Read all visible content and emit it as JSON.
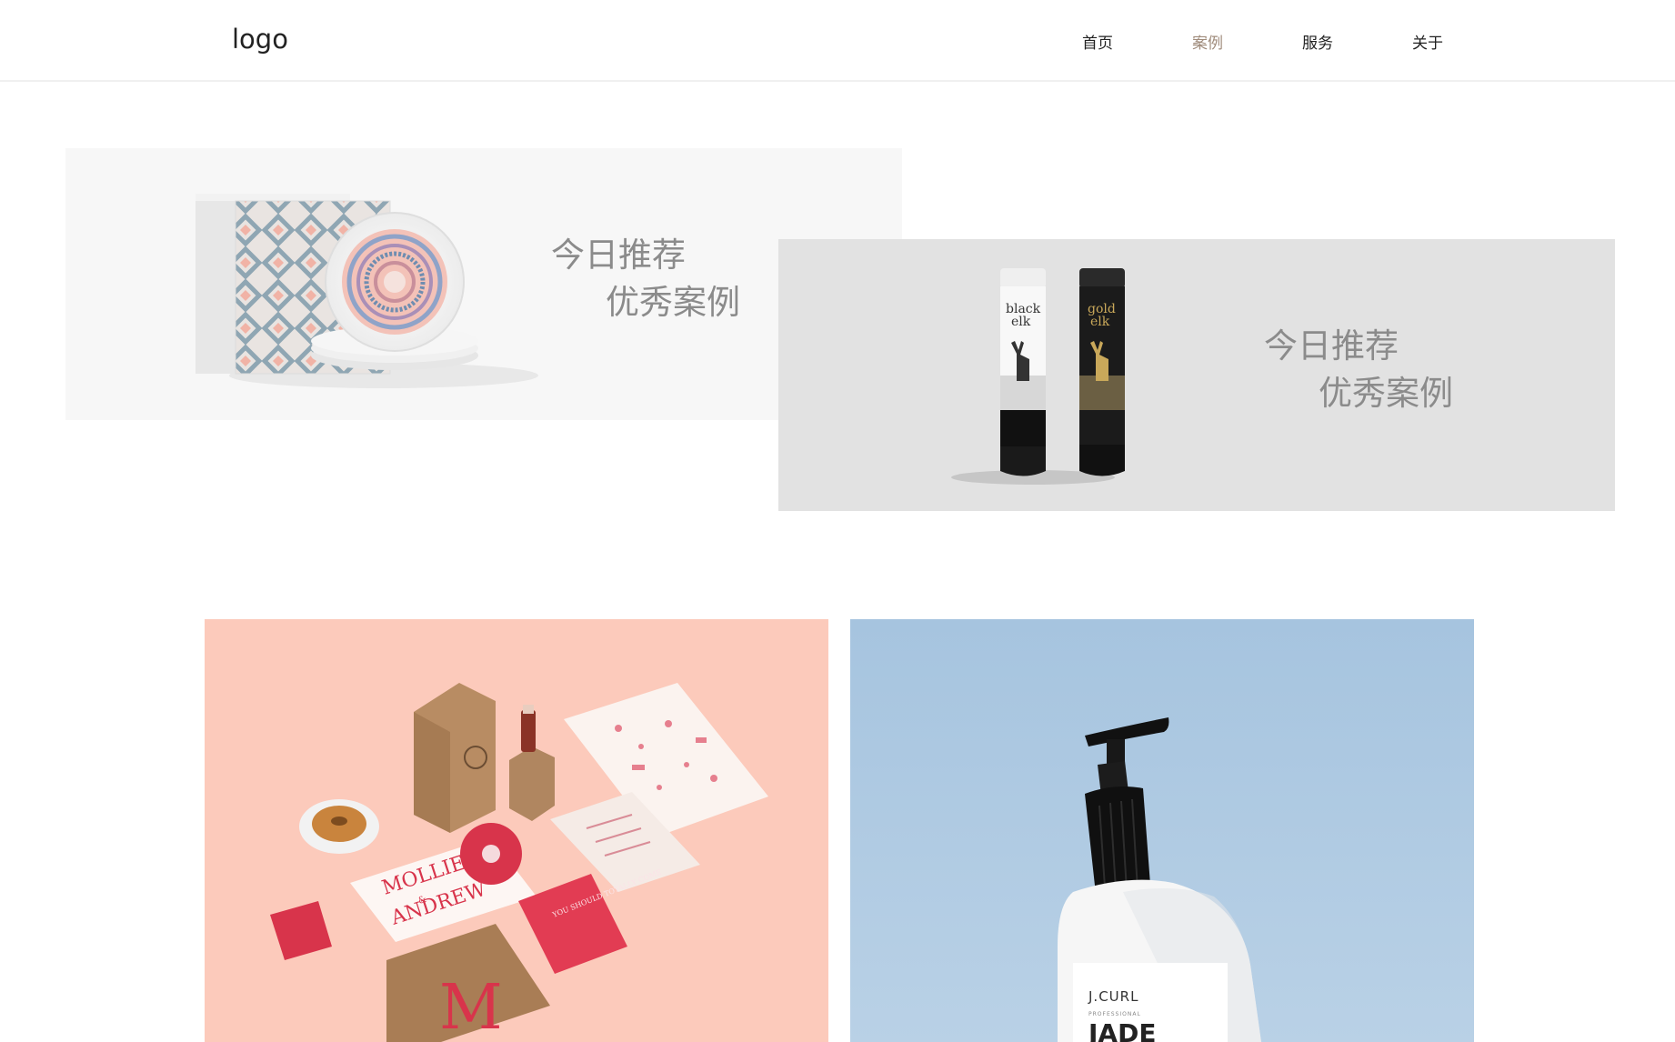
{
  "header": {
    "logo": "logo",
    "nav": [
      {
        "label": "首页",
        "active": false
      },
      {
        "label": "案例",
        "active": true
      },
      {
        "label": "服务",
        "active": false
      },
      {
        "label": "关于",
        "active": false
      }
    ]
  },
  "featured": [
    {
      "title": "今日推荐",
      "subtitle": "优秀案例",
      "image": "boxed-plates-product-photo"
    },
    {
      "title": "今日推荐",
      "subtitle": "优秀案例",
      "image": "black-elk-gold-elk-bottles-photo",
      "product_labels": [
        {
          "line1": "black",
          "line2": "elk"
        },
        {
          "line1": "gold",
          "line2": "elk"
        }
      ]
    }
  ],
  "gallery": [
    {
      "image": "restaurant-branding-stationery-photo",
      "texts": {
        "monogram": "M",
        "card_top": "MOLLIE",
        "card_mid": "&",
        "card_bottom": "ANDREW",
        "red_card": "YOU SHOULD TOTALLY COME"
      }
    },
    {
      "image": "lotion-pump-bottle-photo",
      "texts": {
        "brand": "J.CURL",
        "sub": "PROFESSIONAL",
        "name": "JADE"
      }
    }
  ],
  "colors": {
    "nav_active": "#a08c7c",
    "tagline": "#8b8b8b",
    "pink_bg": "#fccabb",
    "blue_bg": "#a6c4df"
  }
}
